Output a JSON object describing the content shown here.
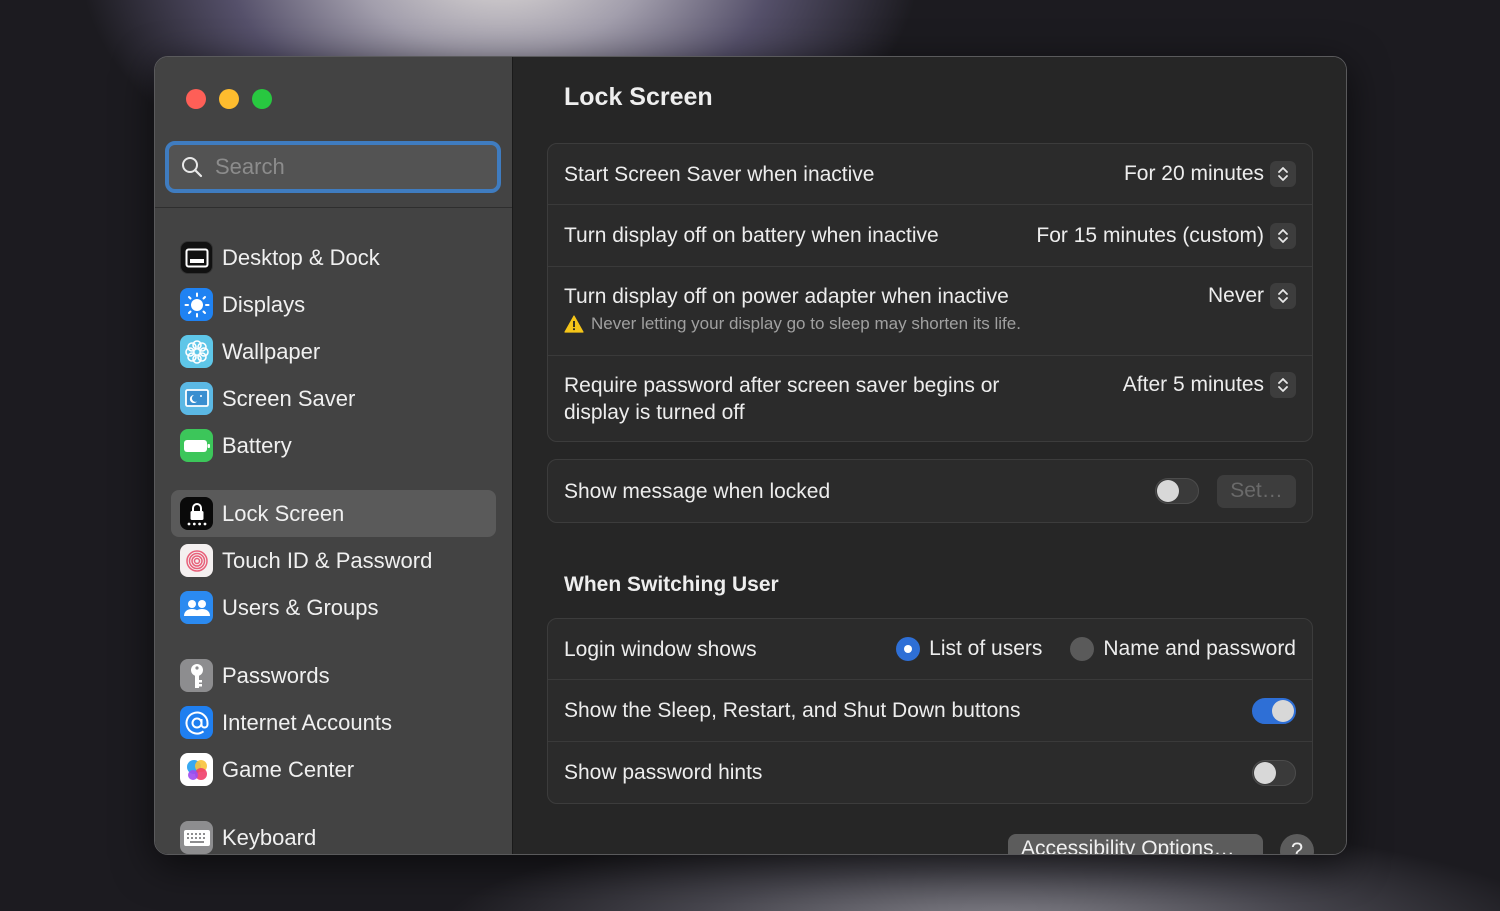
{
  "window": {
    "traffic_lights": [
      "close",
      "minimize",
      "zoom"
    ]
  },
  "sidebar": {
    "search": {
      "placeholder": "Search",
      "value": ""
    },
    "groups": [
      [
        {
          "label": "Desktop & Dock",
          "icon": "desktop-dock-icon",
          "color": "#111111"
        },
        {
          "label": "Displays",
          "icon": "displays-sun-icon",
          "color": "#1f82f2"
        },
        {
          "label": "Wallpaper",
          "icon": "wallpaper-flower-icon",
          "color": "#5ec6e8"
        },
        {
          "label": "Screen Saver",
          "icon": "screen-saver-icon",
          "color": "#5bb8e4"
        },
        {
          "label": "Battery",
          "icon": "battery-icon",
          "color": "#3cc65a"
        }
      ],
      [
        {
          "label": "Lock Screen",
          "icon": "lock-screen-icon",
          "color": "#0a0a0a",
          "selected": true
        },
        {
          "label": "Touch ID & Password",
          "icon": "fingerprint-icon",
          "color": "#f4f0f0"
        },
        {
          "label": "Users & Groups",
          "icon": "users-icon",
          "color": "#2b8af0"
        }
      ],
      [
        {
          "label": "Passwords",
          "icon": "key-icon",
          "color": "#8d8d8f"
        },
        {
          "label": "Internet Accounts",
          "icon": "at-sign-icon",
          "color": "#1f7ff0"
        },
        {
          "label": "Game Center",
          "icon": "game-center-icon",
          "color": "#ffffff"
        }
      ],
      [
        {
          "label": "Keyboard",
          "icon": "keyboard-icon",
          "color": "#8d8d8f"
        }
      ]
    ]
  },
  "main": {
    "title": "Lock Screen",
    "card1": {
      "rows": [
        {
          "label": "Start Screen Saver when inactive",
          "value": "For 20 minutes"
        },
        {
          "label": "Turn display off on battery when inactive",
          "value": "For 15 minutes (custom)"
        },
        {
          "label": "Turn display off on power adapter when inactive",
          "value": "Never",
          "warning": "Never letting your display go to sleep may shorten its life."
        },
        {
          "label_line1": "Require password after screen saver begins or",
          "label_line2": "display is turned off",
          "value": "After 5 minutes"
        }
      ]
    },
    "card2": {
      "label": "Show message when locked",
      "toggle_on": false,
      "set_button": "Set…"
    },
    "section_title": "When Switching User",
    "card3": {
      "login_label": "Login window shows",
      "radio_options": [
        {
          "label": "List of users",
          "selected": true
        },
        {
          "label": "Name and password",
          "selected": false
        }
      ],
      "sleep_restart_label": "Show the Sleep, Restart, and Shut Down buttons",
      "sleep_restart_on": true,
      "hints_label": "Show password hints",
      "hints_on": false
    },
    "accessibility_button": "Accessibility Options…",
    "help_button": "?"
  },
  "colors": {
    "accent": "#2e6fd6",
    "search_focus": "#3f7cc0",
    "warning": "#f5c518"
  }
}
